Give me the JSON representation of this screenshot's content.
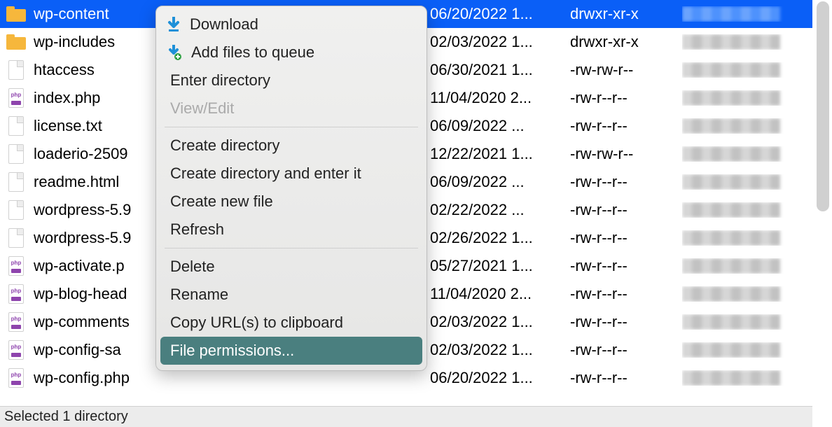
{
  "files": [
    {
      "icon": "folder",
      "name": "wp-content",
      "date": "06/20/2022 1...",
      "perm": "drwxr-xr-x",
      "selected": true
    },
    {
      "icon": "folder",
      "name": "wp-includes",
      "date": "02/03/2022 1...",
      "perm": "drwxr-xr-x"
    },
    {
      "icon": "file",
      "name": "htaccess",
      "date": "06/30/2021 1...",
      "perm": "-rw-rw-r--"
    },
    {
      "icon": "php",
      "name": "index.php",
      "date": "11/04/2020 2...",
      "perm": "-rw-r--r--"
    },
    {
      "icon": "file",
      "name": "license.txt",
      "date": "06/09/2022 ...",
      "perm": "-rw-r--r--"
    },
    {
      "icon": "file",
      "name": "loaderio-2509",
      "date": "12/22/2021 1...",
      "perm": "-rw-rw-r--"
    },
    {
      "icon": "file",
      "name": "readme.html",
      "date": "06/09/2022 ...",
      "perm": "-rw-r--r--"
    },
    {
      "icon": "file",
      "name": "wordpress-5.9",
      "date": "02/22/2022 ...",
      "perm": "-rw-r--r--"
    },
    {
      "icon": "file",
      "name": "wordpress-5.9",
      "date": "02/26/2022 1...",
      "perm": "-rw-r--r--"
    },
    {
      "icon": "php",
      "name": "wp-activate.p",
      "date": "05/27/2021 1...",
      "perm": "-rw-r--r--"
    },
    {
      "icon": "php",
      "name": "wp-blog-head",
      "date": "11/04/2020 2...",
      "perm": "-rw-r--r--"
    },
    {
      "icon": "php",
      "name": "wp-comments",
      "date": "02/03/2022 1...",
      "perm": "-rw-r--r--"
    },
    {
      "icon": "php",
      "name": "wp-config-sa",
      "date": "02/03/2022 1...",
      "perm": "-rw-r--r--"
    },
    {
      "icon": "php",
      "name": "wp-config.php",
      "date": "06/20/2022 1...",
      "perm": "-rw-r--r--"
    }
  ],
  "context_menu": {
    "download": "Download",
    "add_queue": "Add files to queue",
    "enter_dir": "Enter directory",
    "view_edit": "View/Edit",
    "create_dir": "Create directory",
    "create_dir_enter": "Create directory and enter it",
    "create_file": "Create new file",
    "refresh": "Refresh",
    "delete": "Delete",
    "rename": "Rename",
    "copy_url": "Copy URL(s) to clipboard",
    "file_perms": "File permissions..."
  },
  "status": "Selected 1 directory"
}
